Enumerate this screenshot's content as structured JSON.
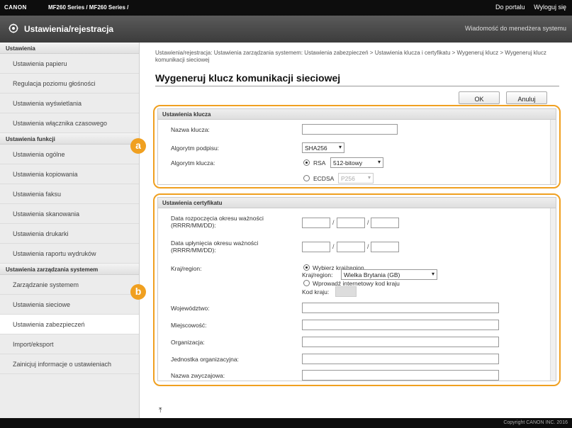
{
  "topbar": {
    "brand": "CANON",
    "model": "MF260 Series / MF260 Series /",
    "portal_link": "Do portalu",
    "logout_link": "Wyloguj się"
  },
  "header": {
    "title": "Ustawienia/rejestracja",
    "admin_message": "Wiadomość do menedżera systemu"
  },
  "sidebar": {
    "sections": [
      {
        "title": "Ustawienia",
        "items": [
          "Ustawienia papieru",
          "Regulacja poziomu głośności",
          "Ustawienia wyświetlania",
          "Ustawienia włącznika czasowego"
        ]
      },
      {
        "title": "Ustawienia funkcji",
        "items": [
          "Ustawienia ogólne",
          "Ustawienia kopiowania",
          "Ustawienia faksu",
          "Ustawienia skanowania",
          "Ustawienia drukarki",
          "Ustawienia raportu wydruków"
        ]
      },
      {
        "title": "Ustawienia zarządzania systemem",
        "items": [
          "Zarządzanie systemem",
          "Ustawienia sieciowe",
          "Ustawienia zabezpieczeń",
          "Import/eksport",
          "Zainicjuj informacje o ustawieniach"
        ]
      }
    ],
    "active_item": "Ustawienia zabezpieczeń"
  },
  "main": {
    "breadcrumb": "Ustawienia/rejestracja: Ustawienia zarządzania systemem: Ustawienia zabezpieczeń > Ustawienia klucza i certyfikatu > Wygeneruj klucz > Wygeneruj klucz komunikacji sieciowej",
    "page_title": "Wygeneruj klucz komunikacji sieciowej",
    "ok_label": "OK",
    "cancel_label": "Anuluj",
    "key_settings": {
      "title": "Ustawienia klucza",
      "key_name_label": "Nazwa klucza:",
      "key_name_value": "",
      "signature_algorithm_label": "Algorytm podpisu:",
      "signature_algorithm_value": "SHA256",
      "key_algorithm_label": "Algorytm klucza:",
      "rsa_label": "RSA",
      "rsa_bits_value": "512-bitowy",
      "ecdsa_label": "ECDSA",
      "ecdsa_curve_value": "P256",
      "selected_algorithm": "RSA"
    },
    "certificate_settings": {
      "title": "Ustawienia certyfikatu",
      "validity_start_label": "Data rozpoczęcia okresu ważności (RRRR/MM/DD):",
      "validity_end_label": "Data upłynięcia okresu ważności (RRRR/MM/DD):",
      "date_separator": "/",
      "country_label": "Kraj/region:",
      "select_country_option": "Wybierz kraj/region",
      "country_sub_label": "Kraj/region:",
      "country_value": "Wielka Brytania (GB)",
      "enter_code_option": "Wprowadź internetowy kod kraju",
      "country_code_label": "Kod kraju:",
      "province_label": "Województwo:",
      "city_label": "Miejscowość:",
      "organization_label": "Organizacja:",
      "org_unit_label": "Jednostka organizacyjna:",
      "common_name_label": "Nazwa zwyczajowa:"
    },
    "callout_a": "a",
    "callout_b": "b",
    "to_top_glyph": "⤒"
  },
  "footer": {
    "copyright": "Copyright CANON INC. 2016"
  },
  "colors": {
    "callout": "#f0a020",
    "topbar": "#0d0d0d",
    "titlebar": "#4a4a4a"
  }
}
